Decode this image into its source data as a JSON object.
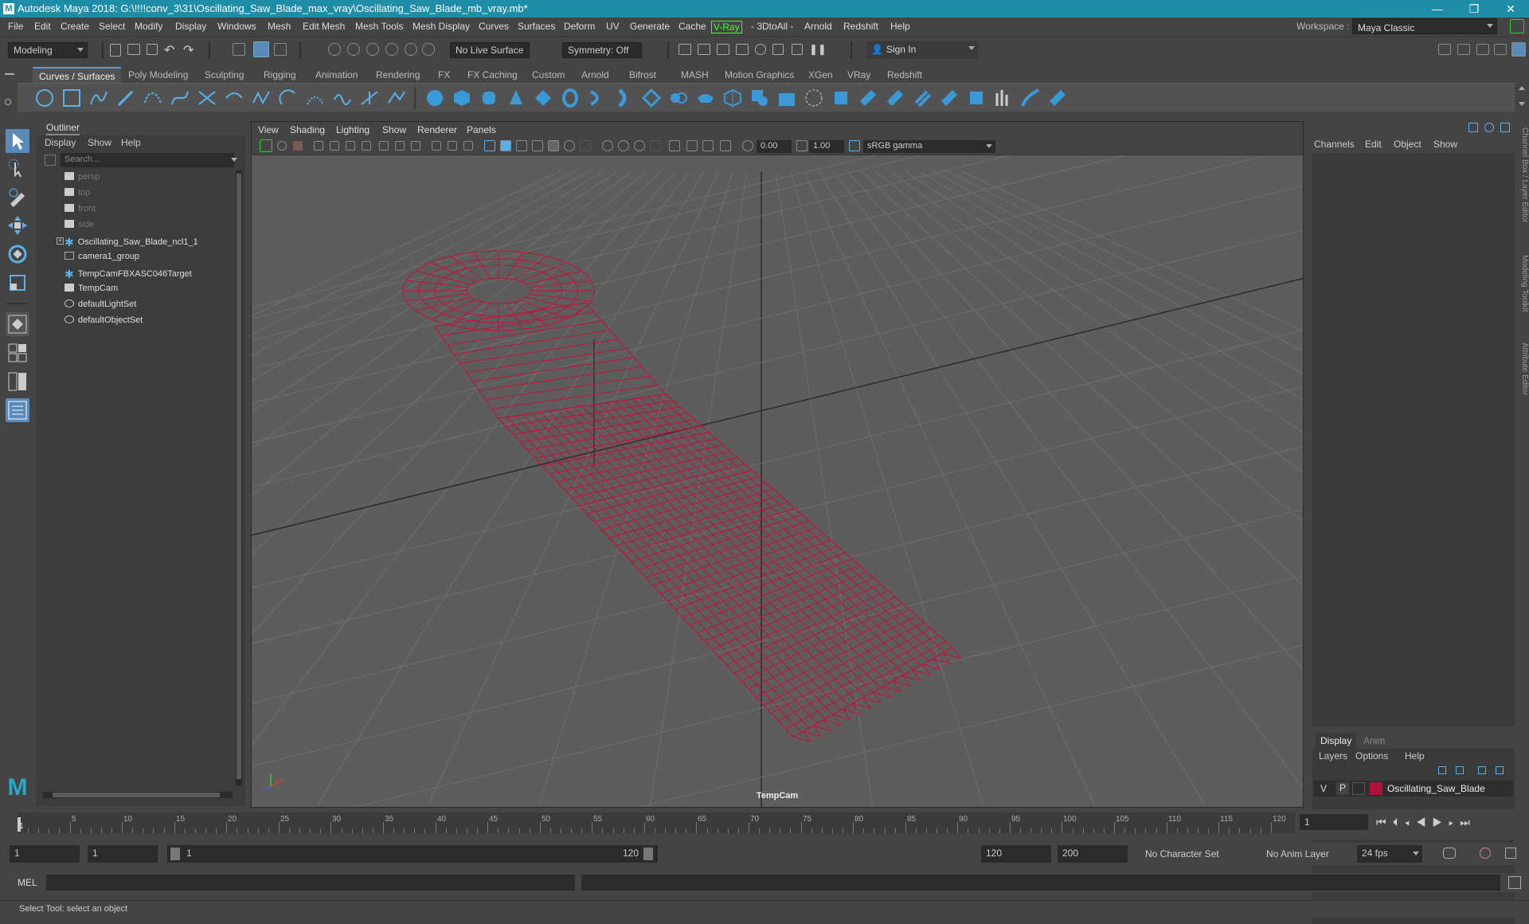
{
  "window": {
    "title": "Autodesk Maya 2018: G:\\!!!!conv_3\\31\\Oscillating_Saw_Blade_max_vray\\Oscillating_Saw_Blade_mb_vray.mb*",
    "workspace_label": "Workspace :",
    "workspace_value": "Maya Classic",
    "minimize": "—",
    "maximize": "❐",
    "close": "✕"
  },
  "menu": [
    "File",
    "Edit",
    "Create",
    "Select",
    "Modify",
    "Display",
    "Windows",
    "Mesh",
    "Edit Mesh",
    "Mesh Tools",
    "Mesh Display",
    "Curves",
    "Surfaces",
    "Deform",
    "UV",
    "Generate",
    "Cache",
    "V-Ray",
    "- 3DtoAll -",
    "Arnold",
    "Redshift",
    "Help"
  ],
  "toolbar": {
    "mode": "Modeling",
    "live_surface": "No Live Surface",
    "symmetry": "Symmetry: Off",
    "sign_in": "Sign In"
  },
  "shelf_tabs": [
    "Curves / Surfaces",
    "Poly Modeling",
    "Sculpting",
    "Rigging",
    "Animation",
    "Rendering",
    "FX",
    "FX Caching",
    "Custom",
    "Arnold",
    "Bifrost",
    "MASH",
    "Motion Graphics",
    "XGen",
    "VRay",
    "Redshift"
  ],
  "outliner": {
    "title": "Outliner",
    "menu": [
      "Display",
      "Show",
      "Help"
    ],
    "search_placeholder": "Search...",
    "items": [
      {
        "label": "persp",
        "type": "camera",
        "dim": true
      },
      {
        "label": "top",
        "type": "camera",
        "dim": true
      },
      {
        "label": "front",
        "type": "camera",
        "dim": true
      },
      {
        "label": "side",
        "type": "camera",
        "dim": true
      },
      {
        "label": "Oscillating_Saw_Blade_ncl1_1",
        "type": "joint",
        "dim": false
      },
      {
        "label": "camera1_group",
        "type": "group",
        "dim": false
      },
      {
        "label": "TempCamFBXASC046Target",
        "type": "joint",
        "dim": false
      },
      {
        "label": "TempCam",
        "type": "camera",
        "dim": false
      },
      {
        "label": "defaultLightSet",
        "type": "set",
        "dim": false
      },
      {
        "label": "defaultObjectSet",
        "type": "set",
        "dim": false
      }
    ]
  },
  "viewport": {
    "menu": [
      "View",
      "Shading",
      "Lighting",
      "Show",
      "Renderer",
      "Panels"
    ],
    "exposure": "0.00",
    "gamma": "1.00",
    "color_space": "sRGB gamma",
    "camera_label": "TempCam",
    "wire_color": "#c8103a"
  },
  "channel_box": {
    "menu": [
      "Channels",
      "Edit",
      "Object",
      "Show"
    ]
  },
  "layers": {
    "tabs": [
      "Display",
      "Anim"
    ],
    "menu": [
      "Layers",
      "Options",
      "Help"
    ],
    "row": {
      "v": "V",
      "p": "P",
      "name": "Oscillating_Saw_Blade",
      "color": "#b0103a"
    }
  },
  "side_labels": [
    "Channel Box / Layer Editor",
    "Modeling Toolkit",
    "Attribute Editor"
  ],
  "timeline": {
    "ticks": [
      5,
      10,
      15,
      20,
      25,
      30,
      35,
      40,
      45,
      50,
      55,
      60,
      65,
      70,
      75,
      80,
      85,
      90,
      95,
      100,
      105,
      110,
      115,
      120
    ],
    "first_frame": "1",
    "current_frame": "1"
  },
  "range": {
    "start": "1",
    "playback_start": "1",
    "slider_start": "1",
    "slider_end": "120",
    "playback_end": "120",
    "end": "200",
    "character_set": "No Character Set",
    "anim_layer": "No Anim Layer",
    "fps": "24 fps"
  },
  "mel": {
    "label": "MEL"
  },
  "status": "Select Tool: select an object"
}
